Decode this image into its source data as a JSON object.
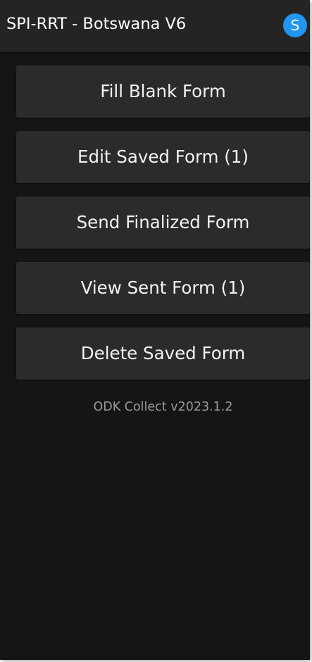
{
  "appbar": {
    "title": "SPI-RRT - Botswana V6",
    "avatar_letter": "S",
    "avatar_color": "#2196f3"
  },
  "menu": {
    "items": [
      {
        "label": "Fill Blank Form"
      },
      {
        "label": "Edit Saved Form (1)"
      },
      {
        "label": "Send Finalized Form"
      },
      {
        "label": "View Sent Form (1)"
      },
      {
        "label": "Delete Saved Form"
      }
    ]
  },
  "footer": {
    "version": "ODK Collect v2023.1.2"
  }
}
